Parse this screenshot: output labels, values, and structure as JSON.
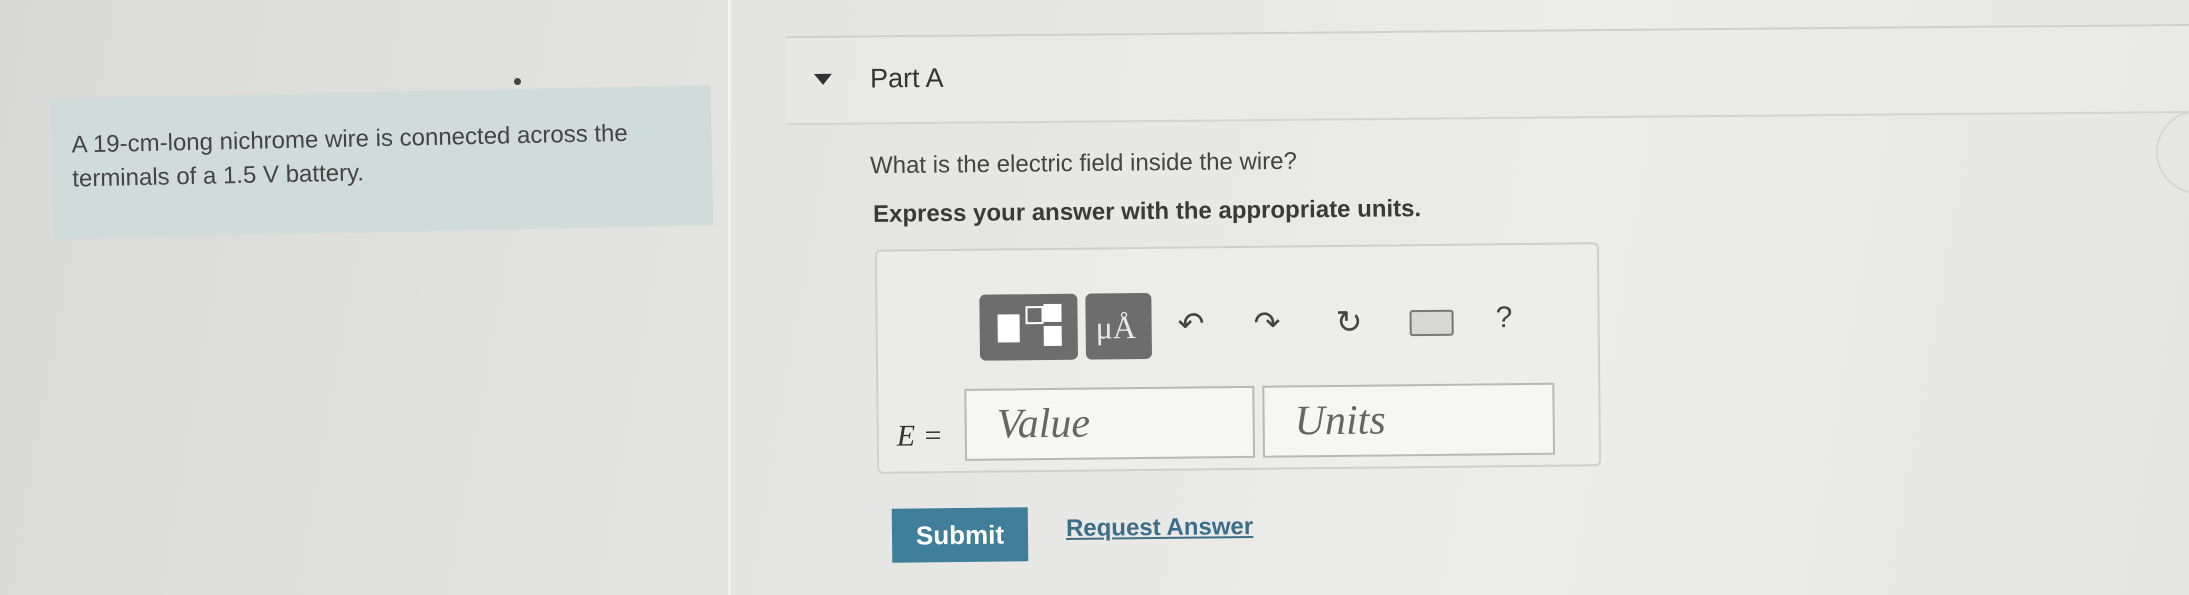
{
  "problem": {
    "text": "A 19-cm-long nichrome wire is connected across the terminals of a 1.5 V battery."
  },
  "part": {
    "title": "Part A",
    "question": "What is the electric field inside the wire?",
    "instruction": "Express your answer with the appropriate units."
  },
  "toolbar": {
    "units_label": "μÅ",
    "help_label": "?",
    "undo_label": "↶",
    "redo_label": "↷",
    "reset_label": "↻"
  },
  "answer": {
    "variable_label": "E =",
    "value_placeholder": "Value",
    "units_placeholder": "Units"
  },
  "actions": {
    "submit_label": "Submit",
    "request_answer_label": "Request Answer"
  }
}
